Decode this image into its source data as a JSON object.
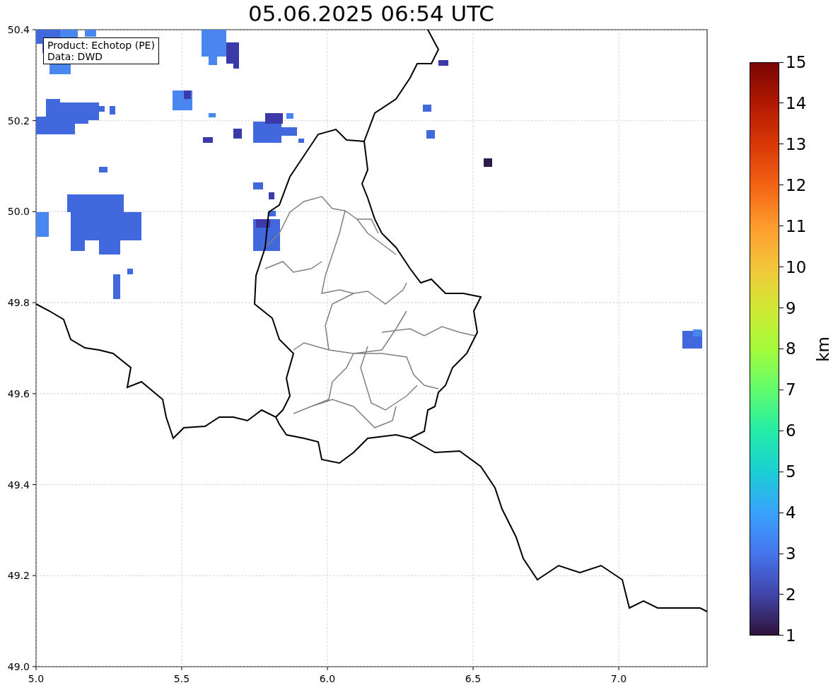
{
  "title": "05.06.2025 06:54 UTC",
  "map": {
    "yticks": [
      "50.4",
      "50.2",
      "50.0",
      "49.8",
      "49.6",
      "49.4",
      "49.2",
      "49.0"
    ],
    "xticks": [
      "5.0",
      "5.5",
      "6.0",
      "6.5",
      "7.0"
    ],
    "annotation": [
      "Product: Echotop (PE)",
      "Data: DWD"
    ]
  },
  "colorbar": {
    "label": "km",
    "ticks": [
      "15",
      "14",
      "13",
      "12",
      "11",
      "10",
      "9",
      "8",
      "7",
      "6",
      "5",
      "4",
      "3",
      "2",
      "1"
    ]
  }
}
